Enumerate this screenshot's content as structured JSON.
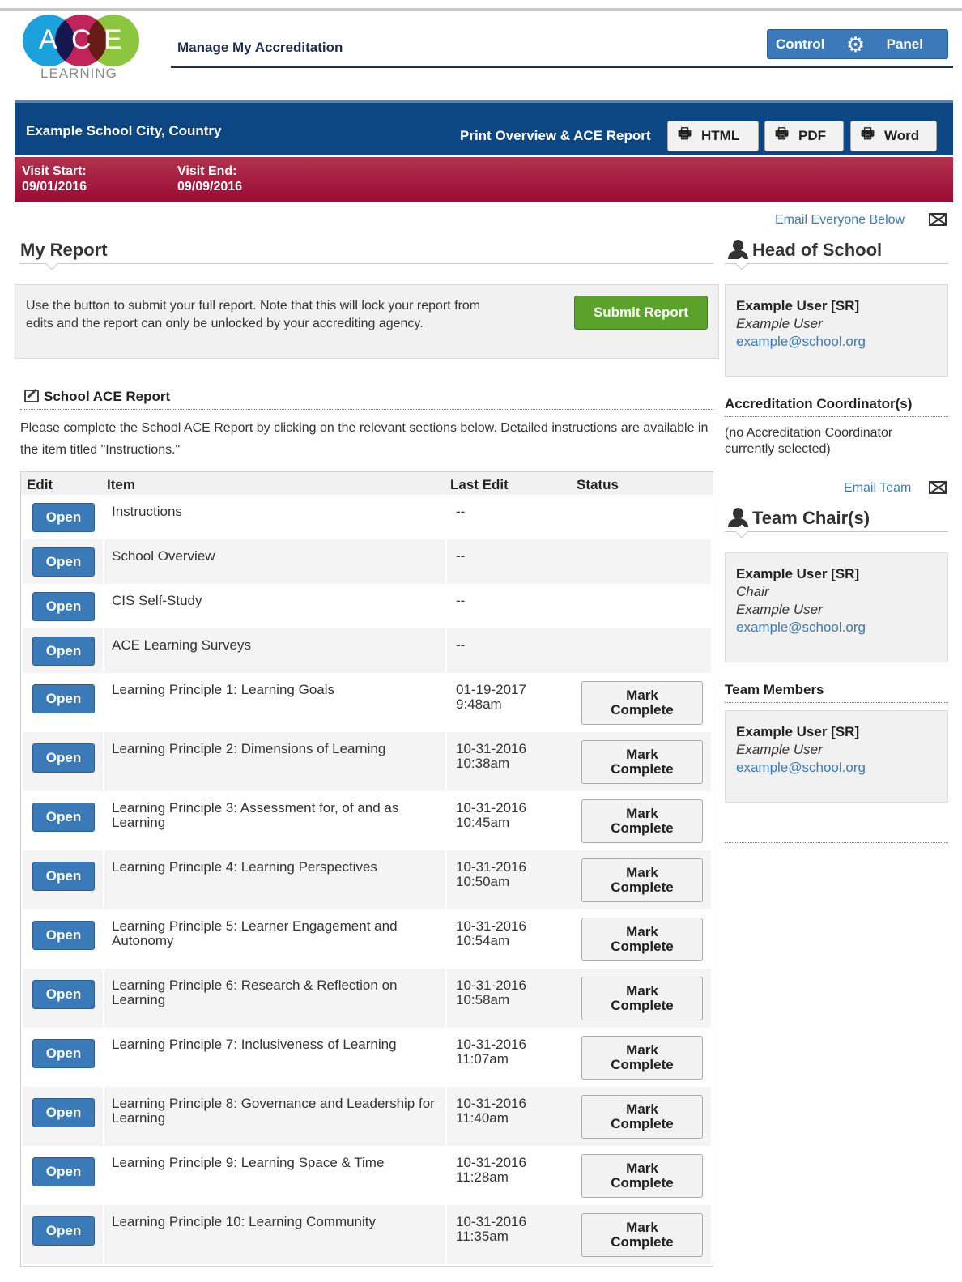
{
  "header": {
    "logo_letters": [
      "A",
      "C",
      "E"
    ],
    "logo_sub": "LEARNING",
    "page_title": "Manage My Accreditation",
    "control_left": "Control",
    "control_right": "Panel",
    "control_icon": "gear-icon"
  },
  "school_bar": {
    "school_name": "Example School City, Country",
    "print_label": "Print Overview & ACE Report",
    "buttons": [
      {
        "label": "HTML",
        "icon": "printer-icon"
      },
      {
        "label": "PDF",
        "icon": "printer-icon"
      },
      {
        "label": "Word",
        "icon": "printer-icon"
      }
    ]
  },
  "visit": {
    "start_label": "Visit Start:",
    "start_date": "09/01/2016",
    "end_label": "Visit End:",
    "end_date": "09/09/2016"
  },
  "report": {
    "heading": "My Report",
    "submit_text": "Use the button to submit your full report. Note that this will lock your report from edits and the report can only be unlocked by your accrediting agency.",
    "submit_label": "Submit Report",
    "ace_title": "School ACE Report",
    "instructions": "Please complete the School ACE Report by clicking on the relevant sections below. Detailed instructions are available in the item titled \"Instructions.\""
  },
  "table": {
    "headers": [
      "Edit",
      "Item",
      "Last Edit",
      "Status"
    ],
    "open_label": "Open",
    "mark_label": "Mark Complete",
    "rows": [
      {
        "item": "Instructions",
        "edit1": "--",
        "edit2": "",
        "mark": false
      },
      {
        "item": "School Overview",
        "edit1": "--",
        "edit2": "",
        "mark": false
      },
      {
        "item": "CIS Self-Study",
        "edit1": "--",
        "edit2": "",
        "mark": false
      },
      {
        "item": "ACE Learning Surveys",
        "edit1": "--",
        "edit2": "",
        "mark": false
      },
      {
        "item": "Learning Principle 1: Learning Goals",
        "edit1": "01-19-2017",
        "edit2": "9:48am",
        "mark": true
      },
      {
        "item": "Learning Principle 2: Dimensions of Learning",
        "edit1": "10-31-2016",
        "edit2": "10:38am",
        "mark": true
      },
      {
        "item": "Learning Principle 3: Assessment for, of and as Learning",
        "edit1": "10-31-2016",
        "edit2": "10:45am",
        "mark": true
      },
      {
        "item": "Learning Principle 4: Learning Perspectives",
        "edit1": "10-31-2016",
        "edit2": "10:50am",
        "mark": true
      },
      {
        "item": "Learning Principle 5: Learner Engagement and Autonomy",
        "edit1": "10-31-2016",
        "edit2": "10:54am",
        "mark": true
      },
      {
        "item": "Learning Principle 6: Research & Reflection on Learning",
        "edit1": "10-31-2016",
        "edit2": "10:58am",
        "mark": true
      },
      {
        "item": "Learning Principle 7: Inclusiveness of Learning",
        "edit1": "10-31-2016",
        "edit2": "11:07am",
        "mark": true
      },
      {
        "item": "Learning Principle 8: Governance and Leadership for Learning",
        "edit1": "10-31-2016",
        "edit2": "11:40am",
        "mark": true
      },
      {
        "item": "Learning Principle 9: Learning Space & Time",
        "edit1": "10-31-2016",
        "edit2": "11:28am",
        "mark": true
      },
      {
        "item": "Learning Principle 10: Learning Community",
        "edit1": "10-31-2016",
        "edit2": "11:35am",
        "mark": true
      }
    ]
  },
  "sidebar": {
    "email_everyone": "Email Everyone Below",
    "head_heading": "Head of School",
    "head": {
      "name": "Example User [SR]",
      "role": "Example User",
      "email": "example@school.org"
    },
    "coord_heading": "Accreditation Coordinator(s)",
    "coord_none": "(no Accreditation Coordinator currently selected)",
    "email_team": "Email Team",
    "chair_heading": "Team Chair(s)",
    "chair": {
      "name": "Example User [SR]",
      "title": "Chair",
      "role": "Example User",
      "email": "example@school.org"
    },
    "members_heading": "Team Members",
    "member": {
      "name": "Example User [SR]",
      "role": "Example User",
      "email": "example@school.org"
    }
  },
  "colors": {
    "nav_blue": "#0d4783",
    "button_blue": "#3b7ab8",
    "visit_red": "#9a0b35",
    "submit_green": "#5aa22a"
  }
}
